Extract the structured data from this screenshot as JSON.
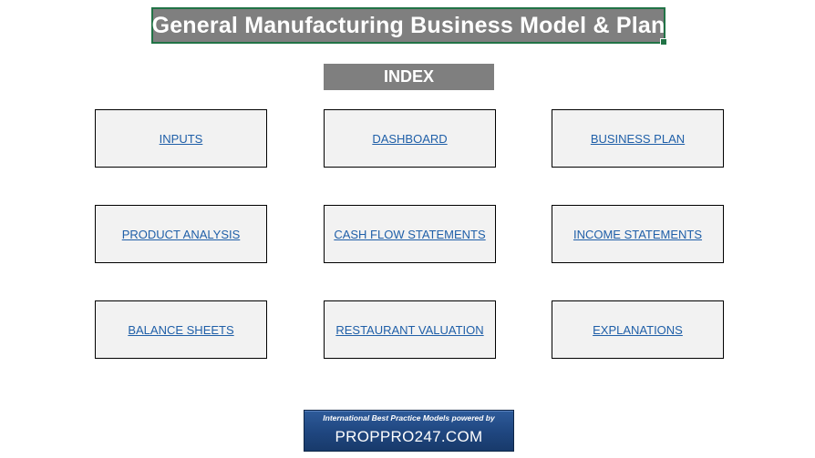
{
  "title": "General Manufacturing Business Model & Plan",
  "index_label": "INDEX",
  "nav": {
    "inputs": "INPUTS",
    "dashboard": "DASHBOARD",
    "business_plan": "BUSINESS PLAN",
    "product_analysis": "PRODUCT ANALYSIS",
    "cash_flow_statements": "CASH FLOW STATEMENTS",
    "income_statements": "INCOME STATEMENTS",
    "balance_sheets": "BALANCE SHEETS",
    "restaurant_valuation": "RESTAURANT VALUATION",
    "explanations": "EXPLANATIONS"
  },
  "brand": {
    "tagline": "International Best Practice Models powered by",
    "name": "PROPPRO247.COM"
  },
  "colors": {
    "header_background": "#7f7f7f",
    "selection_border": "#217346",
    "link": "#1f5fa8",
    "box_background": "#f2f2f2",
    "brand_background": "#1f467f"
  }
}
